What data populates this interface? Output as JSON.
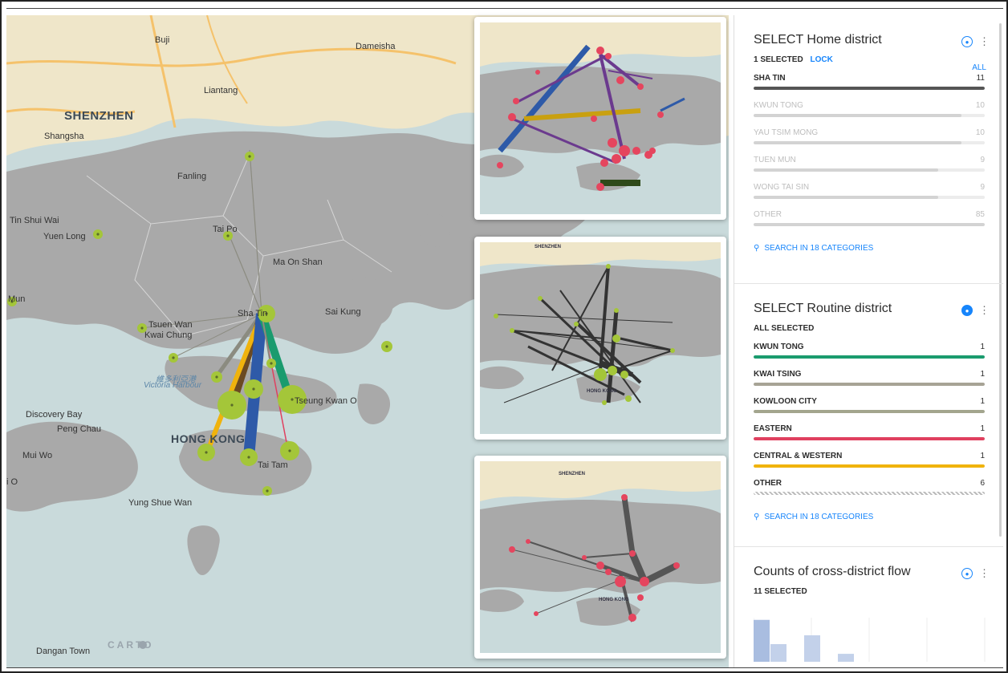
{
  "map": {
    "labels": {
      "shenzhen": "SHENZHEN",
      "buji": "Buji",
      "dameisha": "Dameisha",
      "liantang": "Liantang",
      "shangsha": "Shangsha",
      "fanling": "Fanling",
      "tin_shui_wai": "Tin Shui Wai",
      "yuen_long": "Yuen Long",
      "tai_po": "Tai Po",
      "ma_on_shan": "Ma On Shan",
      "tuen_mun": "Mun",
      "sha_tin": "Sha Tin",
      "sai_kung": "Sai Kung",
      "tsuen_wan": "Tsuen Wan",
      "kwai_chung": "Kwai Chung",
      "victoria_cn": "維多利亞港",
      "victoria": "Victoria Harbour",
      "tseung_kwan_o": "Tseung Kwan O",
      "discovery_bay": "Discovery Bay",
      "peng_chau": "Peng Chau",
      "hong_kong": "HONG KONG",
      "mui_wo": "Mui Wo",
      "tai_tam": "Tai Tam",
      "yung_shue_wan": "Yung Shue Wan",
      "i_o": "i O",
      "dangan_town": "Dangan Town"
    },
    "attribution": "CARTO"
  },
  "minimaps": {
    "shenzhen": "SHENZHEN",
    "hong_kong": "HONG KONG"
  },
  "home_widget": {
    "title": "SELECT Home district",
    "selected_text": "1 SELECTED",
    "lock_label": "LOCK",
    "all_label": "ALL",
    "categories": [
      {
        "name": "SHA TIN",
        "count": "11",
        "selected": true,
        "fraction": 1.0
      },
      {
        "name": "KWUN TONG",
        "count": "10",
        "selected": false,
        "fraction": 0.9
      },
      {
        "name": "YAU TSIM MONG",
        "count": "10",
        "selected": false,
        "fraction": 0.9
      },
      {
        "name": "TUEN MUN",
        "count": "9",
        "selected": false,
        "fraction": 0.8
      },
      {
        "name": "WONG TAI SIN",
        "count": "9",
        "selected": false,
        "fraction": 0.8
      },
      {
        "name": "OTHER",
        "count": "85",
        "selected": false,
        "fraction": 1.0
      }
    ],
    "search_label": "SEARCH IN 18 CATEGORIES"
  },
  "routine_widget": {
    "title": "SELECT Routine district",
    "selected_text": "ALL SELECTED",
    "categories": [
      {
        "name": "KWUN TONG",
        "count": "1",
        "color": "#1a9b6e"
      },
      {
        "name": "KWAI TSING",
        "count": "1",
        "color": "#a7a395"
      },
      {
        "name": "KOWLOON CITY",
        "count": "1",
        "color": "#a3a58e"
      },
      {
        "name": "EASTERN",
        "count": "1",
        "color": "#e0405f"
      },
      {
        "name": "CENTRAL & WESTERN",
        "count": "1",
        "color": "#f0b30d"
      },
      {
        "name": "OTHER",
        "count": "6",
        "color": "hatch"
      }
    ],
    "search_label": "SEARCH IN 18 CATEGORIES"
  },
  "flow_widget": {
    "title": "Counts of cross-district flow",
    "selected_text": "11 SELECTED",
    "histogram": [
      0.95,
      0.4,
      0,
      0.6,
      0,
      0.18,
      0,
      0,
      0,
      0,
      0,
      0,
      0,
      0
    ]
  },
  "colors": {
    "accent": "#1785fb",
    "map_water": "#c9dadb",
    "map_land": "#a9a9a9",
    "node_green": "#a4c639",
    "node_red": "#e5455e"
  }
}
